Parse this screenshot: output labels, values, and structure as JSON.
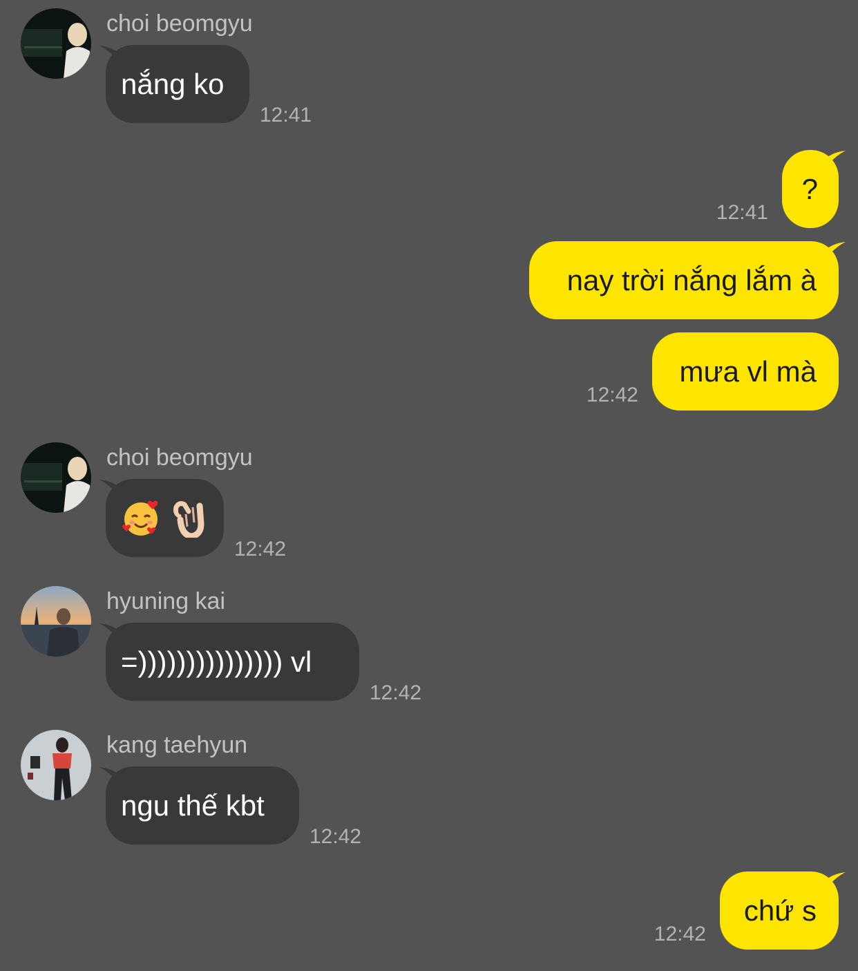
{
  "messages": [
    {
      "type": "incoming",
      "sender": "choi beomgyu",
      "text": "nắng ko",
      "time": "12:41"
    },
    {
      "type": "outgoing",
      "text": "?",
      "time": "12:41"
    },
    {
      "type": "outgoing",
      "text": "nay trời nắng lắm à",
      "time": ""
    },
    {
      "type": "outgoing",
      "text": "mưa vl mà",
      "time": "12:42"
    },
    {
      "type": "incoming",
      "sender": "choi beomgyu",
      "emoji": [
        "smiling-face-with-hearts",
        "ok-hand"
      ],
      "time": "12:42"
    },
    {
      "type": "incoming",
      "sender": "hyuning kai",
      "text": "=))))))))))))))) vl",
      "time": "12:42"
    },
    {
      "type": "incoming",
      "sender": "kang taehyun",
      "text": "ngu thế kbt",
      "time": "12:42"
    },
    {
      "type": "outgoing",
      "text": "chứ s",
      "time": "12:42"
    }
  ],
  "colors": {
    "background": "#545354",
    "incoming_bubble": "#393939",
    "outgoing_bubble": "#fee500",
    "incoming_text": "#ffffff",
    "outgoing_text": "#1a1a1a",
    "meta_text": "#b3b3b6"
  }
}
